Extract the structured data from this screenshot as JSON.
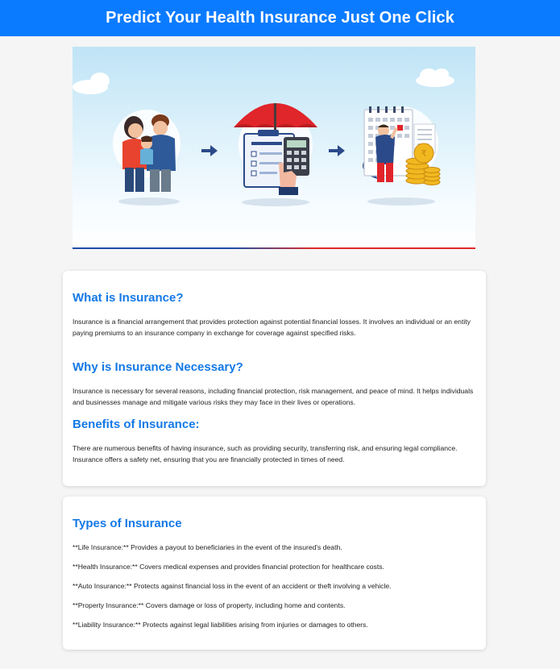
{
  "header": {
    "title": "Predict Your Health Insurance Just One Click"
  },
  "hero": {
    "alt": "Family, insurance form with umbrella and calculator, calendar with coins"
  },
  "info": {
    "what": {
      "heading": "What is Insurance?",
      "text": "Insurance is a financial arrangement that provides protection against potential financial losses. It involves an individual or an entity paying premiums to an insurance company in exchange for coverage against specified risks."
    },
    "why": {
      "heading": "Why is Insurance Necessary?",
      "text": "Insurance is necessary for several reasons, including financial protection, risk management, and peace of mind. It helps individuals and businesses manage and mitigate various risks they may face in their lives or operations."
    },
    "benefits": {
      "heading": "Benefits of Insurance:",
      "text": "There are numerous benefits of having insurance, such as providing security, transferring risk, and ensuring legal compliance. Insurance offers a safety net, ensuring that you are financially protected in times of need."
    }
  },
  "types": {
    "heading": "Types of Insurance",
    "items": [
      "**Life Insurance:** Provides a payout to beneficiaries in the event of the insured's death.",
      "**Health Insurance:** Covers medical expenses and provides financial protection for healthcare costs.",
      "**Auto Insurance:** Protects against financial loss in the event of an accident or theft involving a vehicle.",
      "**Property Insurance:** Covers damage or loss of property, including home and contents.",
      "**Liability Insurance:** Protects against legal liabilities arising from injuries or damages to others."
    ]
  },
  "colors": {
    "header_bg": "#0a7bff",
    "heading": "#1479e6",
    "page_bg": "#f5f5f5"
  }
}
